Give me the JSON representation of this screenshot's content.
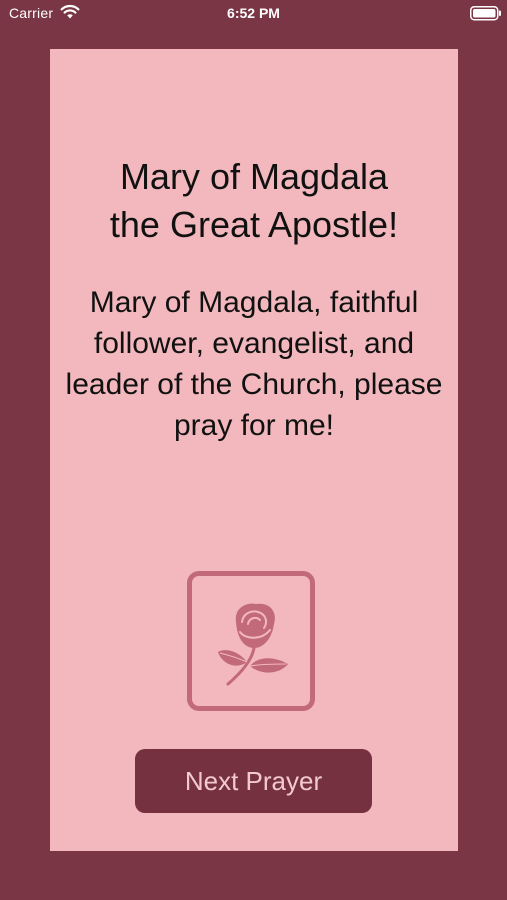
{
  "status_bar": {
    "carrier": "Carrier",
    "time": "6:52 PM",
    "wifi_icon": "wifi-icon",
    "battery_icon": "battery-icon"
  },
  "card": {
    "title_line1": "Mary of Magdala",
    "title_line2": "the Great Apostle!",
    "prayer_text": "Mary of Magdala, faithful follower, evangelist, and leader of the Church, please pray for me!",
    "image_icon": "rose-icon",
    "next_button_label": "Next Prayer"
  },
  "colors": {
    "background": "#7a3645",
    "card": "#f2b8bd",
    "rose_accent": "#c26a7a",
    "button": "#75313f",
    "button_text": "#f2c9cf"
  }
}
